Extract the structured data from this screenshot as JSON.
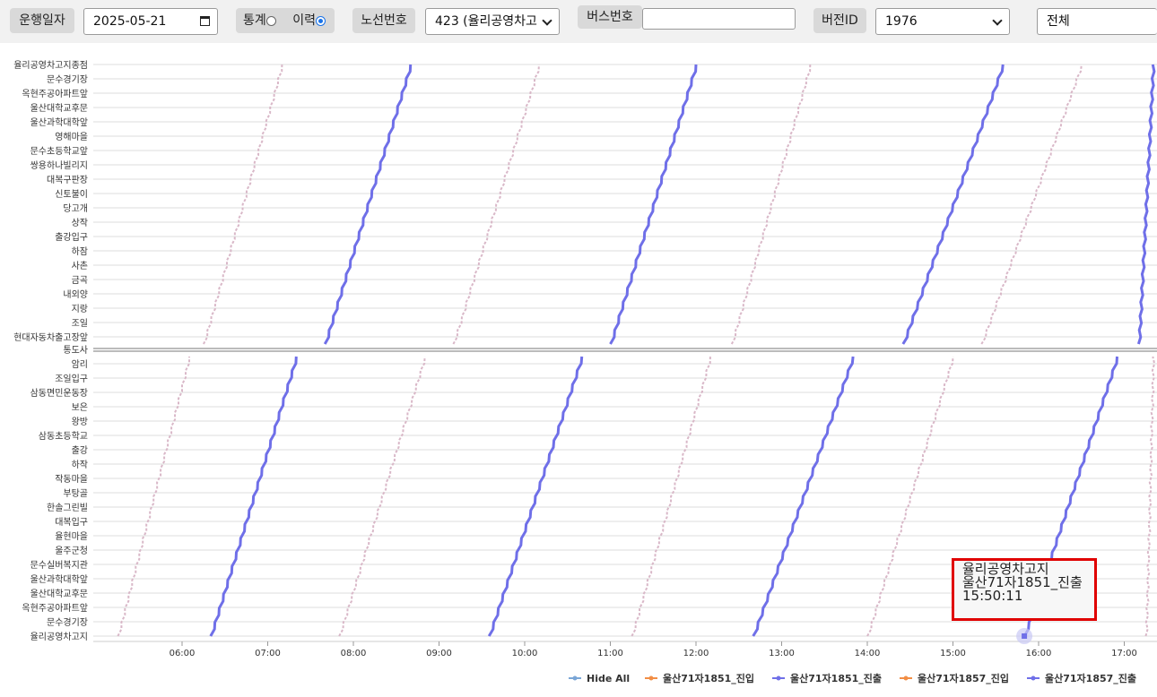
{
  "toolbar": {
    "date_label": "운행일자",
    "date_value": "2025-05-21",
    "mode_stats": "통계",
    "mode_history": "이력",
    "route_label": "노선번호",
    "route_value": "423 (율리공영차고",
    "bus_label": "버스번호",
    "bus_value": "",
    "version_label": "버전ID",
    "version_value": "1976",
    "filter_value": "전체"
  },
  "chart_data": {
    "type": "line",
    "x_ticks": [
      "06:00",
      "07:00",
      "08:00",
      "09:00",
      "10:00",
      "11:00",
      "12:00",
      "13:00",
      "14:00",
      "15:00",
      "16:00",
      "17:00"
    ],
    "x_range": [
      "05:05",
      "17:20"
    ],
    "upper_stops": [
      "율리공영차고지종점",
      "문수경기장",
      "옥현주공아파트앞",
      "울산대학교후문",
      "울산과학대학앞",
      "영해마을",
      "문수초등학교앞",
      "쌍용하나빌리지",
      "대복구판장",
      "신토불이",
      "당고개",
      "상작",
      "출강입구",
      "하잠",
      "사촌",
      "금곡",
      "내외양",
      "지랑",
      "조일",
      "현대자동차출고장앞"
    ],
    "divider_stop": "통도사",
    "lower_stops": [
      "암리",
      "조일입구",
      "삼동면민운동장",
      "보은",
      "왕방",
      "삼동초등학교",
      "출강",
      "하작",
      "작동마을",
      "부탕골",
      "한솔그린빌",
      "대복입구",
      "율현마을",
      "울주군청",
      "문수실버복지관",
      "울산과학대학앞",
      "울산대학교후문",
      "옥현주공아파트앞",
      "문수경기장",
      "율리공영차고지"
    ],
    "series": [
      {
        "name": "울산71자1851_진입",
        "color": "#f28e45"
      },
      {
        "name": "울산71자1851_진출",
        "color": "#6f6fe8"
      },
      {
        "name": "울산71자1857_진입",
        "color": "#f28e45"
      },
      {
        "name": "울산71자1857_진출",
        "color": "#6f6fe8"
      }
    ],
    "legend": {
      "hide_all": "Hide All",
      "position": "bottom-right"
    },
    "trips_1851": [
      {
        "leg": "out",
        "start": "06:20",
        "end": "07:20"
      },
      {
        "leg": "in",
        "start": "07:40",
        "end": "08:40"
      },
      {
        "leg": "out",
        "start": "09:35",
        "end": "10:40"
      },
      {
        "leg": "in",
        "start": "11:00",
        "end": "12:00"
      },
      {
        "leg": "out",
        "start": "12:40",
        "end": "13:50"
      },
      {
        "leg": "in",
        "start": "14:25",
        "end": "15:35"
      },
      {
        "leg": "out",
        "start": "15:50",
        "end": "16:55"
      },
      {
        "leg": "in",
        "start": "17:10",
        "end": "17:20"
      }
    ],
    "trips_1857": [
      {
        "leg": "out",
        "start": "05:15",
        "end": "06:05"
      },
      {
        "leg": "in",
        "start": "06:15",
        "end": "07:10"
      },
      {
        "leg": "out",
        "start": "07:50",
        "end": "08:50"
      },
      {
        "leg": "in",
        "start": "09:10",
        "end": "10:10"
      },
      {
        "leg": "out",
        "start": "11:15",
        "end": "12:10"
      },
      {
        "leg": "in",
        "start": "12:25",
        "end": "13:20"
      },
      {
        "leg": "out",
        "start": "14:00",
        "end": "15:00"
      },
      {
        "leg": "in",
        "start": "15:20",
        "end": "16:30"
      },
      {
        "leg": "out",
        "start": "17:15",
        "end": "17:20"
      }
    ],
    "tooltip": {
      "line1": "율리공영차고지",
      "line2": "울산71자1851_진출",
      "line3": "15:50:11"
    }
  }
}
